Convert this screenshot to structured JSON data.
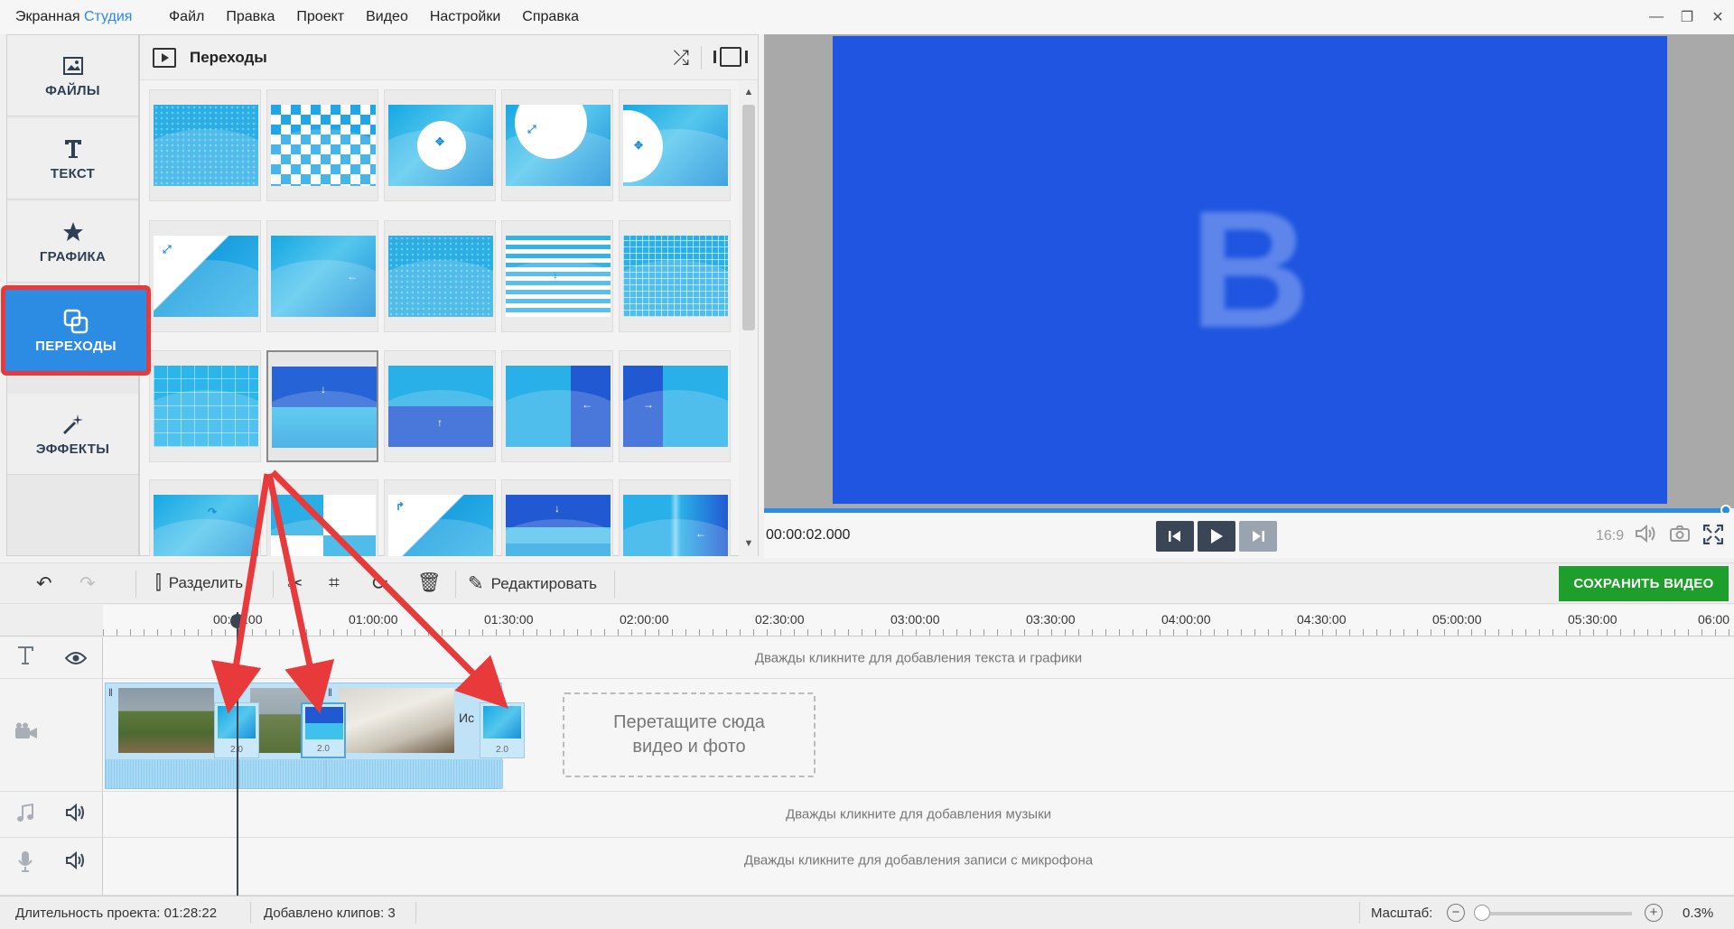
{
  "app": {
    "title_main": "Экранная",
    "title_accent": "Студия",
    "accent_color": "#2c8be3"
  },
  "menu": [
    "Файл",
    "Правка",
    "Проект",
    "Видео",
    "Настройки",
    "Справка"
  ],
  "window_controls": {
    "minimize": "—",
    "restore": "❐",
    "close": "✕"
  },
  "sidebar": {
    "items": [
      {
        "label": "ФАЙЛЫ",
        "icon": "image-icon"
      },
      {
        "label": "ТЕКСТ",
        "icon": "text-icon"
      },
      {
        "label": "ГРАФИКА",
        "icon": "star-icon"
      },
      {
        "label": "ПЕРЕХОДЫ",
        "icon": "transitions-icon",
        "active": true
      },
      {
        "label": "ЭФФЕКТЫ",
        "icon": "magic-wand-icon"
      }
    ],
    "highlight_color": "#e83a3a"
  },
  "transitions_panel": {
    "title": "Переходы",
    "grid_rows": 4,
    "grid_cols": 5,
    "selected_index": 11
  },
  "preview": {
    "letter": "B",
    "background_color": "#1f55e0",
    "timecode": "00:00:02.000",
    "aspect_ratio": "16:9",
    "progress_percent": 100
  },
  "toolbar": {
    "split_label": "Разделить",
    "edit_label": "Редактировать",
    "save_label": "СОХРАНИТЬ ВИДЕО",
    "save_color": "#1e9e2b"
  },
  "ruler": {
    "labels": [
      "00:30:00",
      "01:00:00",
      "01:30:00",
      "02:00:00",
      "02:30:00",
      "03:00:00",
      "03:30:00",
      "04:00:00",
      "04:30:00",
      "05:00:00",
      "05:30:00",
      "06:00"
    ]
  },
  "tracks": {
    "text_hint": "Дважды кликните для добавления текста и графики",
    "drop_hint_line1": "Перетащите сюда",
    "drop_hint_line2": "видео и фото",
    "music_hint": "Дважды кликните для добавления музыки",
    "mic_hint": "Дважды кликните для добавления записи с микрофона",
    "clip_label_fragment": "Ис",
    "transitions": [
      {
        "duration": "2.0"
      },
      {
        "duration": "2.0"
      },
      {
        "duration": "2.0"
      }
    ]
  },
  "status": {
    "duration_label": "Длительность проекта:",
    "duration_value": "01:28:22",
    "clips_label": "Добавлено клипов:",
    "clips_value": "3",
    "zoom_label": "Масштаб:",
    "zoom_value": "0.3%"
  },
  "annotation": {
    "arrow_color": "#e83a3a"
  }
}
